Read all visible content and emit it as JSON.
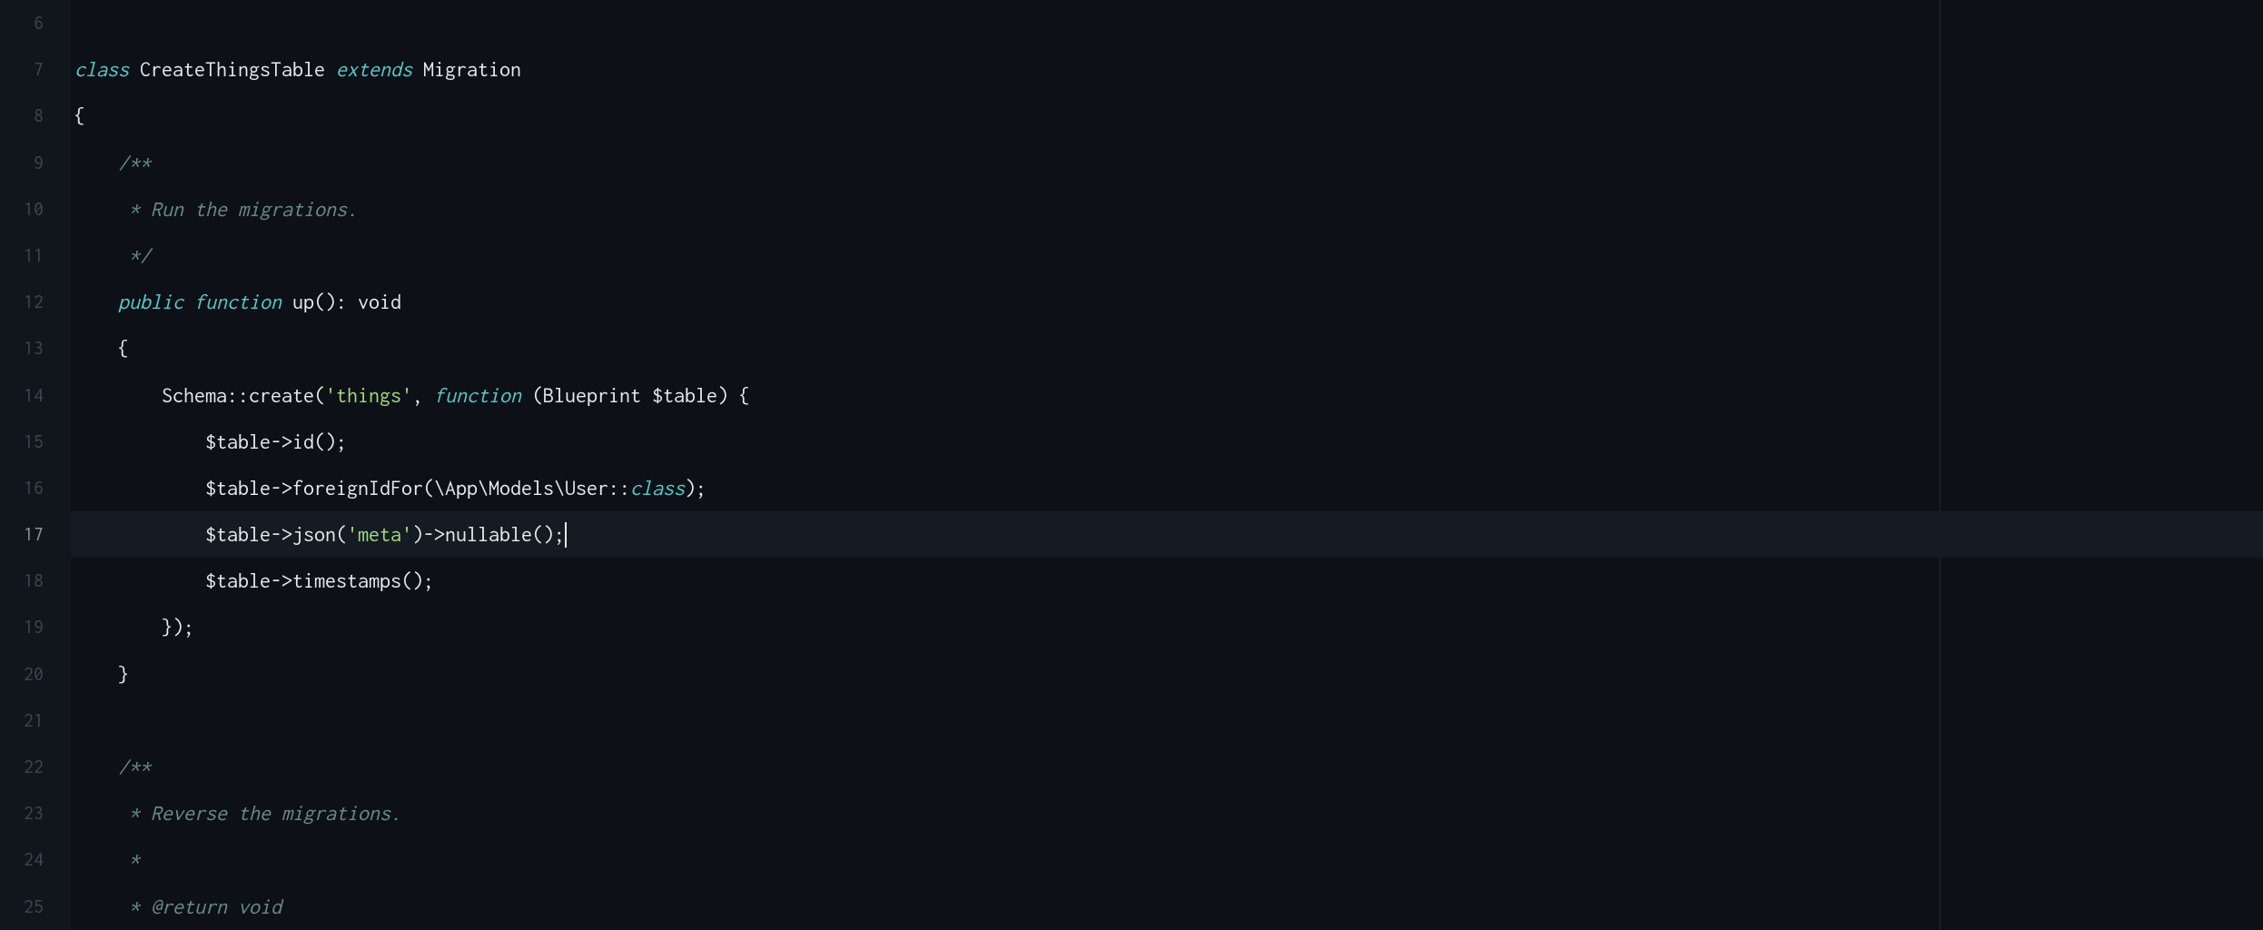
{
  "editor": {
    "current_line": 17,
    "ruler_column": 120,
    "lines": [
      {
        "num": 6,
        "tokens": []
      },
      {
        "num": 7,
        "tokens": [
          {
            "cls": "tk-kw",
            "t": "class"
          },
          {
            "cls": "tk-punc",
            "t": " "
          },
          {
            "cls": "tk-type",
            "t": "CreateThingsTable"
          },
          {
            "cls": "tk-punc",
            "t": " "
          },
          {
            "cls": "tk-kw",
            "t": "extends"
          },
          {
            "cls": "tk-punc",
            "t": " "
          },
          {
            "cls": "tk-type",
            "t": "Migration"
          }
        ]
      },
      {
        "num": 8,
        "tokens": [
          {
            "cls": "tk-punc",
            "t": "{"
          }
        ]
      },
      {
        "num": 9,
        "tokens": [
          {
            "cls": "tk-punc",
            "t": "    "
          },
          {
            "cls": "tk-comment",
            "t": "/**"
          }
        ]
      },
      {
        "num": 10,
        "tokens": [
          {
            "cls": "tk-punc",
            "t": "    "
          },
          {
            "cls": "tk-comment",
            "t": " * Run the migrations."
          }
        ]
      },
      {
        "num": 11,
        "tokens": [
          {
            "cls": "tk-punc",
            "t": "    "
          },
          {
            "cls": "tk-comment",
            "t": " */"
          }
        ]
      },
      {
        "num": 12,
        "tokens": [
          {
            "cls": "tk-punc",
            "t": "    "
          },
          {
            "cls": "tk-kw",
            "t": "public"
          },
          {
            "cls": "tk-punc",
            "t": " "
          },
          {
            "cls": "tk-kw",
            "t": "function"
          },
          {
            "cls": "tk-punc",
            "t": " "
          },
          {
            "cls": "tk-fn",
            "t": "up"
          },
          {
            "cls": "tk-punc",
            "t": "(): "
          },
          {
            "cls": "tk-type",
            "t": "void"
          }
        ]
      },
      {
        "num": 13,
        "tokens": [
          {
            "cls": "tk-punc",
            "t": "    {"
          }
        ]
      },
      {
        "num": 14,
        "tokens": [
          {
            "cls": "tk-punc",
            "t": "        "
          },
          {
            "cls": "tk-type",
            "t": "Schema"
          },
          {
            "cls": "tk-punc",
            "t": "::"
          },
          {
            "cls": "tk-fn",
            "t": "create"
          },
          {
            "cls": "tk-punc",
            "t": "("
          },
          {
            "cls": "tk-str",
            "t": "'things'"
          },
          {
            "cls": "tk-punc",
            "t": ", "
          },
          {
            "cls": "tk-kw",
            "t": "function"
          },
          {
            "cls": "tk-punc",
            "t": " ("
          },
          {
            "cls": "tk-type",
            "t": "Blueprint"
          },
          {
            "cls": "tk-punc",
            "t": " "
          },
          {
            "cls": "tk-var",
            "t": "$table"
          },
          {
            "cls": "tk-punc",
            "t": ") {"
          }
        ]
      },
      {
        "num": 15,
        "tokens": [
          {
            "cls": "tk-punc",
            "t": "            "
          },
          {
            "cls": "tk-var",
            "t": "$table"
          },
          {
            "cls": "tk-punc",
            "t": "->"
          },
          {
            "cls": "tk-fn",
            "t": "id"
          },
          {
            "cls": "tk-punc",
            "t": "();"
          }
        ]
      },
      {
        "num": 16,
        "tokens": [
          {
            "cls": "tk-punc",
            "t": "            "
          },
          {
            "cls": "tk-var",
            "t": "$table"
          },
          {
            "cls": "tk-punc",
            "t": "->"
          },
          {
            "cls": "tk-fn",
            "t": "foreignIdFor"
          },
          {
            "cls": "tk-punc",
            "t": "(\\App\\Models\\User::"
          },
          {
            "cls": "tk-kw",
            "t": "class"
          },
          {
            "cls": "tk-punc",
            "t": ");"
          }
        ]
      },
      {
        "num": 17,
        "tokens": [
          {
            "cls": "tk-punc",
            "t": "            "
          },
          {
            "cls": "tk-var",
            "t": "$table"
          },
          {
            "cls": "tk-punc",
            "t": "->"
          },
          {
            "cls": "tk-fn",
            "t": "json"
          },
          {
            "cls": "tk-punc",
            "t": "("
          },
          {
            "cls": "tk-str",
            "t": "'meta'"
          },
          {
            "cls": "tk-punc",
            "t": ")->"
          },
          {
            "cls": "tk-fn",
            "t": "nullable"
          },
          {
            "cls": "tk-punc",
            "t": "();"
          }
        ]
      },
      {
        "num": 18,
        "tokens": [
          {
            "cls": "tk-punc",
            "t": "            "
          },
          {
            "cls": "tk-var",
            "t": "$table"
          },
          {
            "cls": "tk-punc",
            "t": "->"
          },
          {
            "cls": "tk-fn",
            "t": "timestamps"
          },
          {
            "cls": "tk-punc",
            "t": "();"
          }
        ]
      },
      {
        "num": 19,
        "tokens": [
          {
            "cls": "tk-punc",
            "t": "        });"
          }
        ]
      },
      {
        "num": 20,
        "tokens": [
          {
            "cls": "tk-punc",
            "t": "    }"
          }
        ]
      },
      {
        "num": 21,
        "tokens": []
      },
      {
        "num": 22,
        "tokens": [
          {
            "cls": "tk-punc",
            "t": "    "
          },
          {
            "cls": "tk-comment",
            "t": "/**"
          }
        ]
      },
      {
        "num": 23,
        "tokens": [
          {
            "cls": "tk-punc",
            "t": "    "
          },
          {
            "cls": "tk-comment",
            "t": " * Reverse the migrations."
          }
        ]
      },
      {
        "num": 24,
        "tokens": [
          {
            "cls": "tk-punc",
            "t": "    "
          },
          {
            "cls": "tk-comment",
            "t": " *"
          }
        ]
      },
      {
        "num": 25,
        "tokens": [
          {
            "cls": "tk-punc",
            "t": "    "
          },
          {
            "cls": "tk-comment",
            "t": " * "
          },
          {
            "cls": "tk-doctag",
            "t": "@return"
          },
          {
            "cls": "tk-comment",
            "t": " void"
          }
        ]
      }
    ]
  }
}
